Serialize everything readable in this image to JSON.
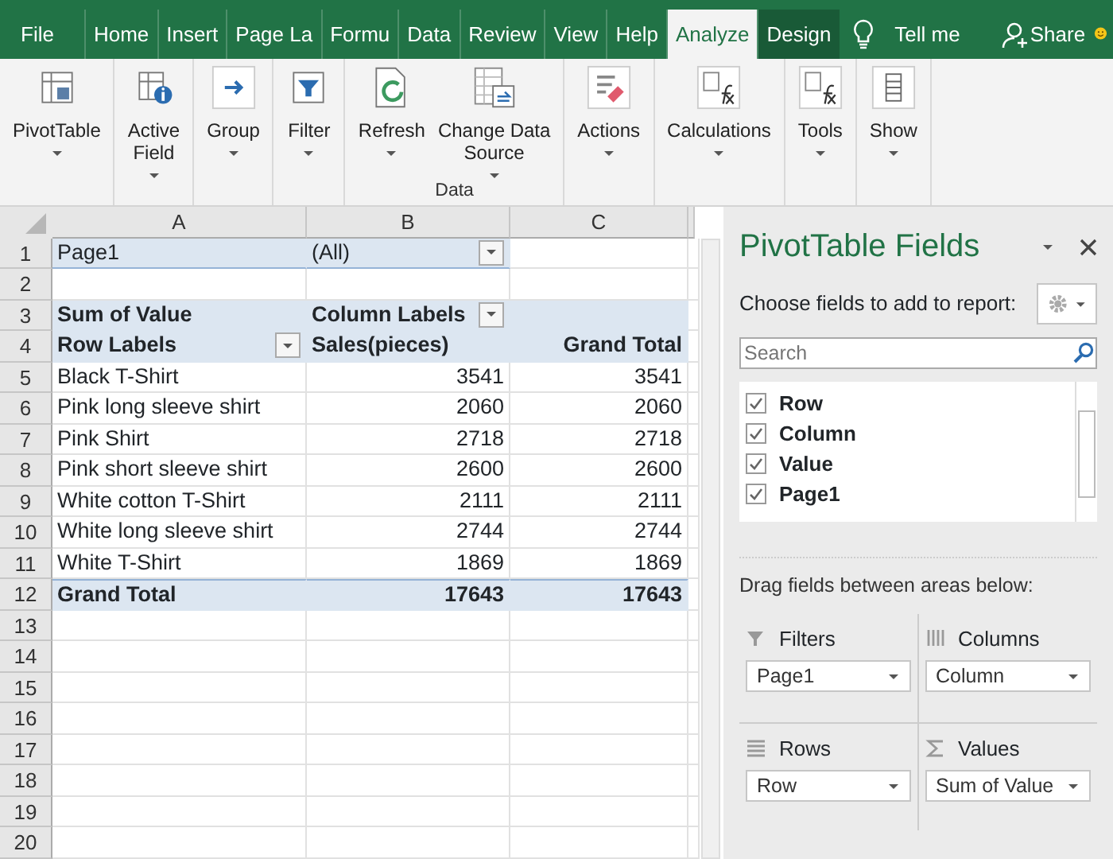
{
  "tabs": [
    {
      "label": "File",
      "selected": false,
      "contextual": false
    },
    {
      "label": "Home",
      "selected": false,
      "contextual": false
    },
    {
      "label": "Insert",
      "selected": false,
      "contextual": false
    },
    {
      "label": "Page La",
      "selected": false,
      "contextual": false
    },
    {
      "label": "Formu",
      "selected": false,
      "contextual": false
    },
    {
      "label": "Data",
      "selected": false,
      "contextual": false
    },
    {
      "label": "Review",
      "selected": false,
      "contextual": false
    },
    {
      "label": "View",
      "selected": false,
      "contextual": false
    },
    {
      "label": "Help",
      "selected": false,
      "contextual": false
    },
    {
      "label": "Analyze",
      "selected": true,
      "contextual": true
    },
    {
      "label": "Design",
      "selected": false,
      "contextual": true
    }
  ],
  "tell_me": "Tell me",
  "share": "Share",
  "ribbon": [
    {
      "buttons": [
        {
          "lines": [
            "PivotTable"
          ]
        }
      ]
    },
    {
      "buttons": [
        {
          "lines": [
            "Active",
            "Field"
          ]
        }
      ]
    },
    {
      "buttons": [
        {
          "lines": [
            "Group"
          ]
        }
      ]
    },
    {
      "buttons": [
        {
          "lines": [
            "Filter"
          ]
        }
      ]
    },
    {
      "label": "Data",
      "buttons": [
        {
          "lines": [
            "Refresh"
          ]
        },
        {
          "lines": [
            "Change Data",
            "Source"
          ]
        }
      ]
    },
    {
      "buttons": [
        {
          "lines": [
            "Actions"
          ]
        }
      ]
    },
    {
      "buttons": [
        {
          "lines": [
            "Calculations"
          ]
        }
      ]
    },
    {
      "buttons": [
        {
          "lines": [
            "Tools"
          ]
        }
      ]
    },
    {
      "buttons": [
        {
          "lines": [
            "Show"
          ]
        }
      ]
    }
  ],
  "sheet": {
    "columns": [
      "A",
      "B",
      "C"
    ],
    "rows": [
      {
        "number": "1",
        "kind": "page",
        "cells": [
          {
            "text": "Page1"
          },
          {
            "text": "(All)",
            "filter": true
          },
          {
            "text": ""
          }
        ]
      },
      {
        "number": "2",
        "kind": "blank"
      },
      {
        "number": "3",
        "kind": "header",
        "cells": [
          {
            "text": "Sum of Value"
          },
          {
            "text": "Column Labels",
            "filter": true
          },
          {
            "text": ""
          }
        ]
      },
      {
        "number": "4",
        "kind": "header",
        "cells": [
          {
            "text": "Row Labels",
            "filter": true
          },
          {
            "text": "Sales(pieces)"
          },
          {
            "text": "Grand Total"
          }
        ]
      },
      {
        "number": "5",
        "kind": "data",
        "cells": [
          {
            "text": "Black T-Shirt"
          },
          {
            "text": "3541"
          },
          {
            "text": "3541"
          }
        ]
      },
      {
        "number": "6",
        "kind": "data",
        "cells": [
          {
            "text": "Pink long sleeve shirt"
          },
          {
            "text": "2060"
          },
          {
            "text": "2060"
          }
        ]
      },
      {
        "number": "7",
        "kind": "data",
        "cells": [
          {
            "text": "Pink Shirt"
          },
          {
            "text": "2718"
          },
          {
            "text": "2718"
          }
        ]
      },
      {
        "number": "8",
        "kind": "data",
        "cells": [
          {
            "text": "Pink short sleeve shirt"
          },
          {
            "text": "2600"
          },
          {
            "text": "2600"
          }
        ]
      },
      {
        "number": "9",
        "kind": "data",
        "cells": [
          {
            "text": "White cotton T-Shirt"
          },
          {
            "text": "2111"
          },
          {
            "text": "2111"
          }
        ]
      },
      {
        "number": "10",
        "kind": "data",
        "cells": [
          {
            "text": "White long sleeve shirt"
          },
          {
            "text": "2744"
          },
          {
            "text": "2744"
          }
        ]
      },
      {
        "number": "11",
        "kind": "data",
        "cells": [
          {
            "text": "White T-Shirt"
          },
          {
            "text": "1869"
          },
          {
            "text": "1869"
          }
        ]
      },
      {
        "number": "12",
        "kind": "total",
        "cells": [
          {
            "text": "Grand Total"
          },
          {
            "text": "17643"
          },
          {
            "text": "17643"
          }
        ]
      },
      {
        "number": "13",
        "kind": "blank"
      },
      {
        "number": "14",
        "kind": "blank"
      },
      {
        "number": "15",
        "kind": "blank"
      },
      {
        "number": "16",
        "kind": "blank"
      },
      {
        "number": "17",
        "kind": "blank"
      },
      {
        "number": "18",
        "kind": "blank"
      },
      {
        "number": "19",
        "kind": "blank"
      },
      {
        "number": "20",
        "kind": "blank"
      }
    ]
  },
  "pane": {
    "title": "PivotTable Fields",
    "subtitle": "Choose fields to add to report:",
    "search": {
      "placeholder": "Search"
    },
    "fields": [
      {
        "label": "Row",
        "checked": true
      },
      {
        "label": "Column",
        "checked": true
      },
      {
        "label": "Value",
        "checked": true
      },
      {
        "label": "Page1",
        "checked": true
      }
    ],
    "areas_hint": "Drag fields between areas below:",
    "areas": [
      {
        "name": "Filters",
        "kind": "filters",
        "items": [
          "Page1"
        ]
      },
      {
        "name": "Columns",
        "kind": "columns",
        "items": [
          "Column"
        ]
      },
      {
        "name": "Rows",
        "kind": "rows",
        "items": [
          "Row"
        ]
      },
      {
        "name": "Values",
        "kind": "values",
        "items": [
          "Sum of Value"
        ]
      }
    ]
  }
}
